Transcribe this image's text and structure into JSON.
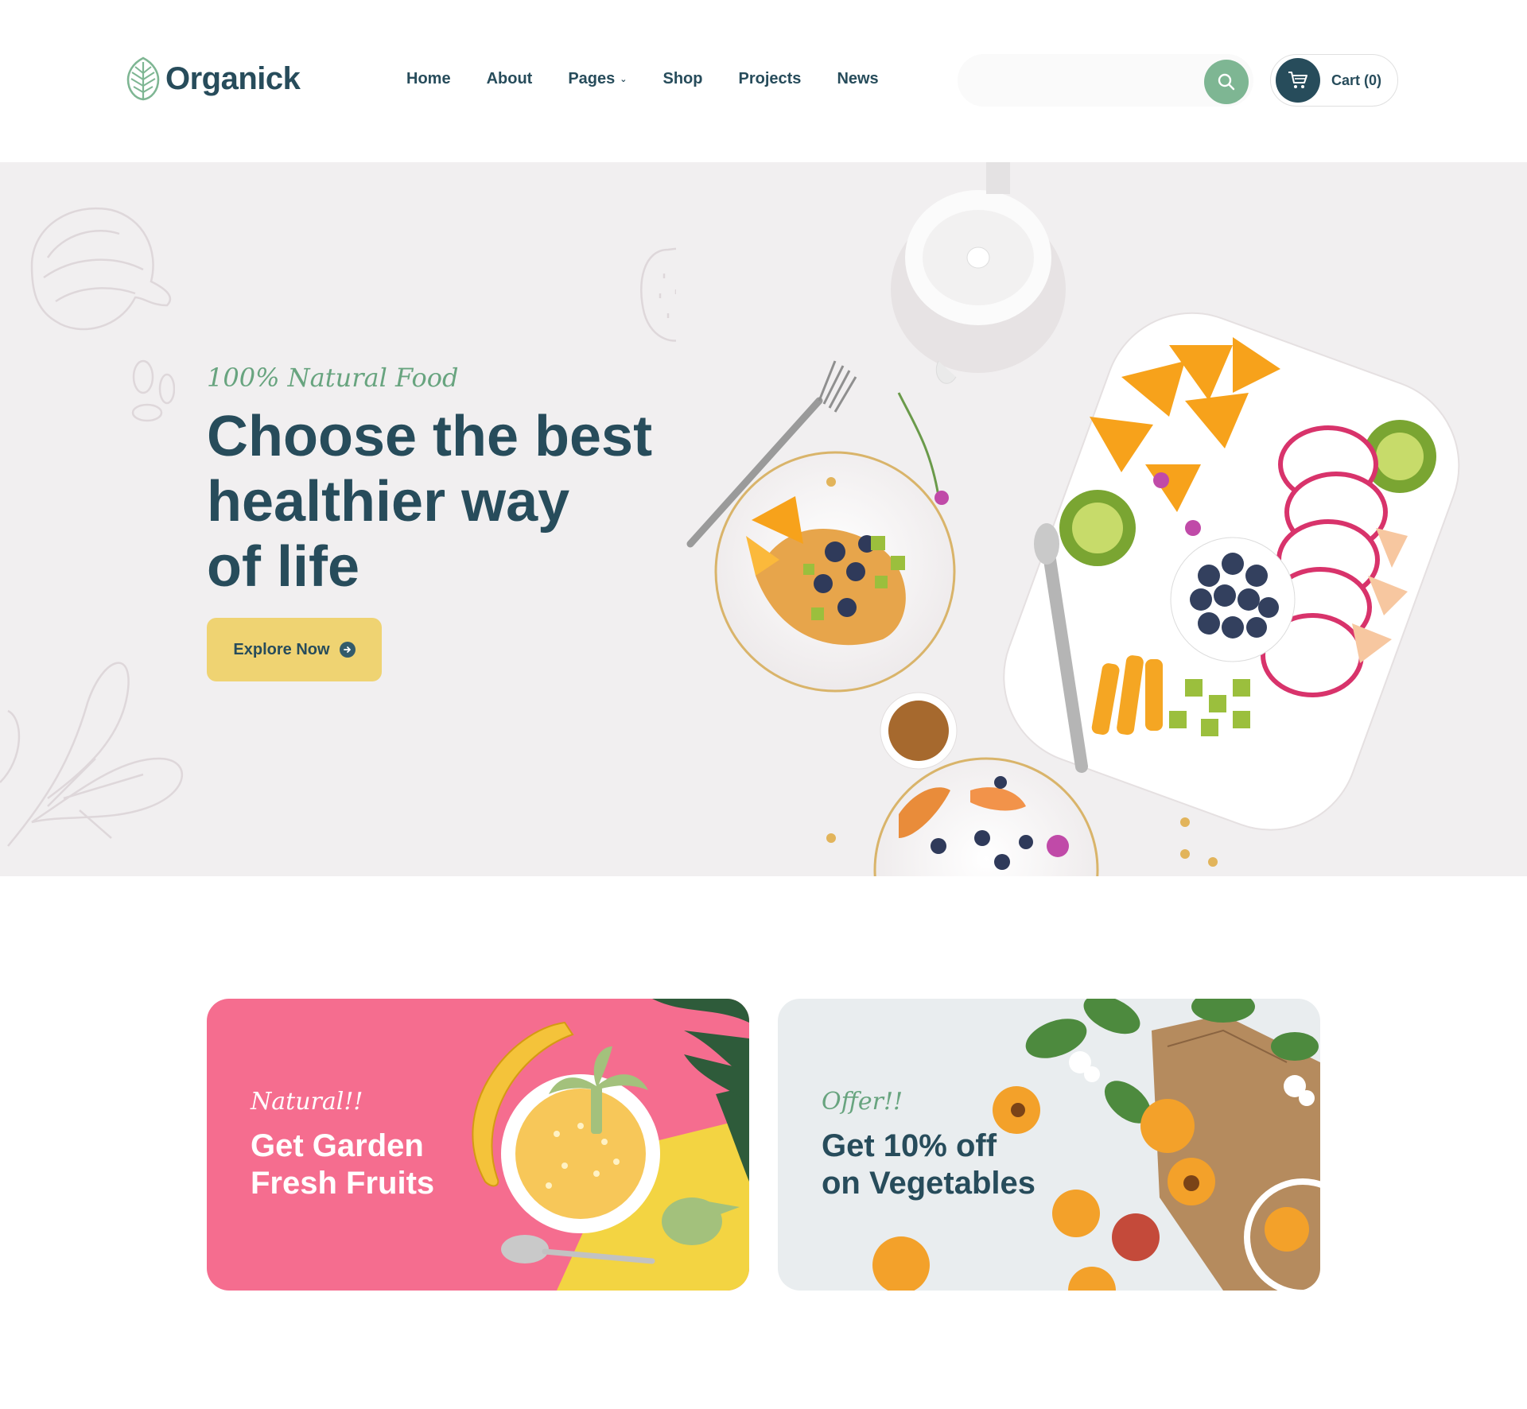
{
  "brand": {
    "name": "Organick"
  },
  "nav": {
    "items": [
      {
        "label": "Home"
      },
      {
        "label": "About"
      },
      {
        "label": "Pages",
        "has_dropdown": true
      },
      {
        "label": "Shop"
      },
      {
        "label": "Projects"
      },
      {
        "label": "News"
      }
    ]
  },
  "search": {
    "placeholder": "",
    "icon": "search-icon"
  },
  "cart": {
    "label": "Cart (0)",
    "icon": "cart-icon"
  },
  "hero": {
    "tagline": "100% Natural Food",
    "title_lines": [
      "Choose the best",
      "healthier way",
      "of life"
    ],
    "cta_label": "Explore Now"
  },
  "offers": [
    {
      "tag": "Natural!!",
      "title_lines": [
        "Get Garden",
        "Fresh Fruits"
      ]
    },
    {
      "tag": "Offer!!",
      "title_lines": [
        "Get 10% off",
        "on Vegetables"
      ]
    }
  ],
  "colors": {
    "primary": "#274c5b",
    "accent_green": "#7eb693",
    "tag_green": "#68a47f",
    "cta_yellow": "#efd372",
    "hero_bg": "#f1eff0",
    "card_pink": "#f56d8f",
    "card_light": "#e9edef"
  }
}
